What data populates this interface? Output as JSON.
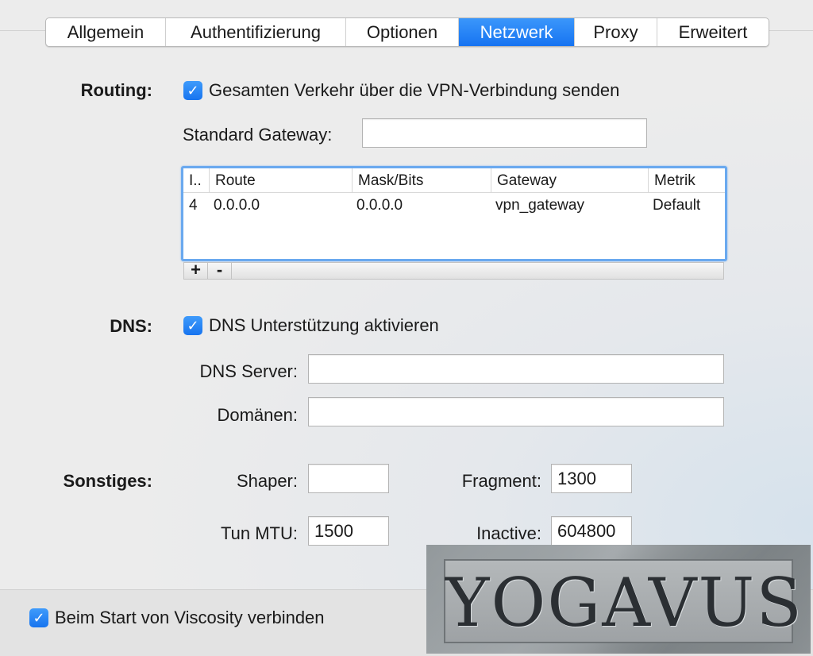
{
  "tabs": [
    "Allgemein",
    "Authentifizierung",
    "Optionen",
    "Netzwerk",
    "Proxy",
    "Erweitert"
  ],
  "active_tab": "Netzwerk",
  "routing": {
    "label": "Routing:",
    "send_all_traffic": {
      "checked": true,
      "label": "Gesamten Verkehr über die VPN-Verbindung senden"
    },
    "gateway_label": "Standard Gateway:",
    "gateway_value": ""
  },
  "routes_table": {
    "columns": [
      "I..",
      "Route",
      "Mask/Bits",
      "Gateway",
      "Metrik"
    ],
    "rows": [
      {
        "index": "4",
        "route": "0.0.0.0",
        "mask": "0.0.0.0",
        "gateway": "vpn_gateway",
        "metric": "Default"
      }
    ],
    "add_label": "+",
    "remove_label": "-"
  },
  "dns": {
    "label": "DNS:",
    "enable": {
      "checked": true,
      "label": "DNS Unterstützung aktivieren"
    },
    "server_label": "DNS Server:",
    "server_value": "",
    "domains_label": "Domänen:",
    "domains_value": ""
  },
  "misc": {
    "label": "Sonstiges:",
    "shaper_label": "Shaper:",
    "shaper_value": "",
    "fragment_label": "Fragment:",
    "fragment_value": "1300",
    "tun_mtu_label": "Tun MTU:",
    "tun_mtu_value": "1500",
    "inactive_label": "Inactive:",
    "inactive_value": "604800"
  },
  "footer": {
    "connect_on_start": {
      "checked": true,
      "label": "Beim Start von Viscosity verbinden"
    }
  },
  "watermark": {
    "text": "YOGAVUS"
  },
  "colors": {
    "accent": "#1a78f2",
    "focus_ring": "#6aa9ef"
  }
}
